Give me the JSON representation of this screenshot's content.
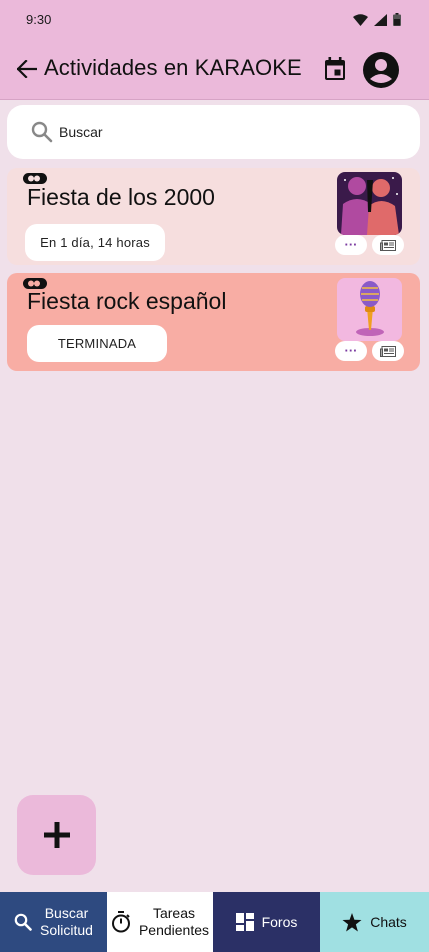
{
  "status_bar": {
    "time": "9:30"
  },
  "app_bar": {
    "title": "Actividades en KARAOKE"
  },
  "search": {
    "value": "Buscar"
  },
  "activities": [
    {
      "title": "Fiesta de los 2000",
      "status": "En 1 día, 14 horas",
      "thumb_icon": "party-silhouettes",
      "bg_color": "#f6dede"
    },
    {
      "title": "Fiesta rock español",
      "status": "TERMINADA",
      "thumb_icon": "microphone",
      "bg_color": "#f8ada4"
    }
  ],
  "card_actions": {
    "more": "···"
  },
  "fab": {
    "icon": "plus-icon"
  },
  "bottom_nav": [
    {
      "label": "Buscar\nSolicitud",
      "icon": "search-icon",
      "color": "#2e4a80"
    },
    {
      "label": "Tareas\nPendientes",
      "icon": "timer-icon",
      "color": "#ffffff"
    },
    {
      "label": "Foros",
      "icon": "dashboard-icon",
      "color": "#2b3066"
    },
    {
      "label": "Chats",
      "icon": "star-icon",
      "color": "#a0e0e2"
    }
  ],
  "colors": {
    "app_bar": "#ebb9da",
    "background": "#f0e0ea"
  }
}
